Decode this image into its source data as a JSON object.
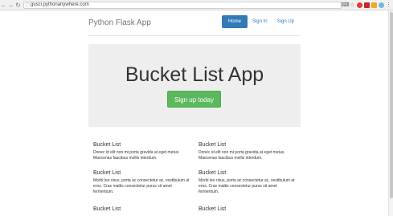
{
  "browser": {
    "url": "gusci.pythonanywhere.com"
  },
  "header": {
    "brand": "Python Flask App",
    "nav": [
      {
        "label": "Home",
        "active": true
      },
      {
        "label": "Sign In",
        "active": false
      },
      {
        "label": "Sign Up",
        "active": false
      }
    ]
  },
  "jumbotron": {
    "title": "Bucket List App",
    "button_label": "Sign up today"
  },
  "marketing": [
    {
      "heading": "Bucket List",
      "text": "Donec id elit non mi porta gravida at eget metus. Maecenas faucibus mollis interdum."
    },
    {
      "heading": "Bucket List",
      "text": "Donec id elit non mi porta gravida at eget metus. Maecenas faucibus mollis interdum."
    },
    {
      "heading": "Bucket List",
      "text": "Morbi leo risus, porta ac consectetur ac, vestibulum at eros. Cras mattis consectetur purus sit amet fermentum."
    },
    {
      "heading": "Bucket List",
      "text": "Morbi leo risus, porta ac consectetur ac, vestibulum at eros. Cras mattis consectetur purus sit amet fermentum."
    },
    {
      "heading": "Bucket List",
      "text": ""
    },
    {
      "heading": "Bucket List",
      "text": ""
    }
  ],
  "colors": {
    "primary": "#337ab7",
    "success": "#5cb85c",
    "jumbotron_bg": "#eeeeee"
  }
}
